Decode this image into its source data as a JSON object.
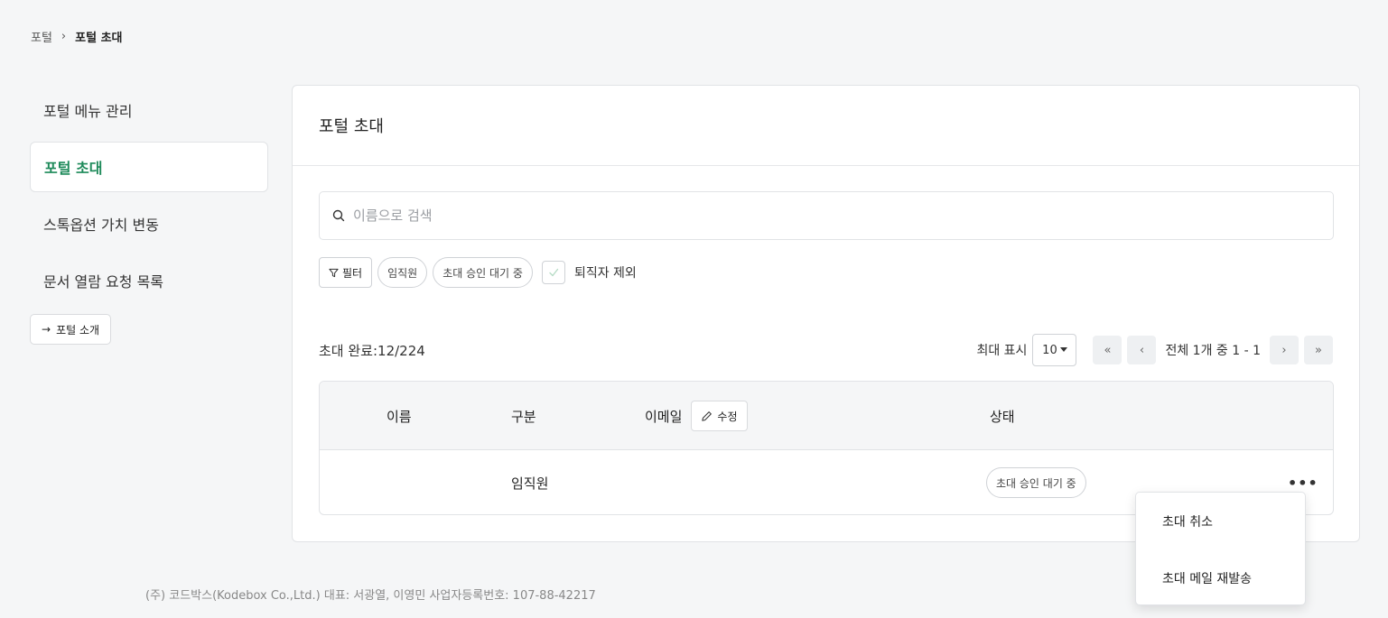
{
  "breadcrumb": {
    "root": "포털",
    "separator": "›",
    "current": "포털 초대"
  },
  "sidebar": {
    "items": [
      {
        "label": "포털 메뉴 관리",
        "active": false
      },
      {
        "label": "포털 초대",
        "active": true
      },
      {
        "label": "스톡옵션 가치 변동",
        "active": false
      },
      {
        "label": "문서 열람 요청 목록",
        "active": false
      }
    ],
    "intro_button": {
      "arrow": "→",
      "label": "포털 소개"
    }
  },
  "card": {
    "title": "포털 초대",
    "search": {
      "placeholder": "이름으로 검색",
      "icon": "search-icon"
    },
    "filters": {
      "filter_button": "필터",
      "chips": [
        "임직원",
        "초대 승인 대기 중"
      ],
      "exclude_resigned": {
        "label": "퇴직자 제외",
        "checked": true
      }
    },
    "count_label": "초대 완료:12/224",
    "pagination": {
      "page_size_label": "최대 표시",
      "page_size": "10",
      "first": "«",
      "prev": "‹",
      "info": "전체 1개 중 1 - 1",
      "next": "›",
      "last": "»"
    },
    "table": {
      "headers": {
        "name": "이름",
        "type": "구분",
        "email": "이메일",
        "edit": "수정",
        "status": "상태"
      },
      "rows": [
        {
          "name": "",
          "type": "임직원",
          "email": "",
          "status": "초대 승인 대기 중",
          "more": "•••"
        }
      ]
    }
  },
  "context_menu": {
    "items": [
      "초대 취소",
      "초대 메일 재발송"
    ]
  },
  "footer": {
    "line1": "(주) 코드박스(Kodebox Co.,Ltd.) 대표: 서광열, 이영민 사업자등록번호: 107-88-42217"
  },
  "colors": {
    "accent": "#1e8a5a",
    "background": "#f5f6f7",
    "border": "#e1e3e6"
  }
}
